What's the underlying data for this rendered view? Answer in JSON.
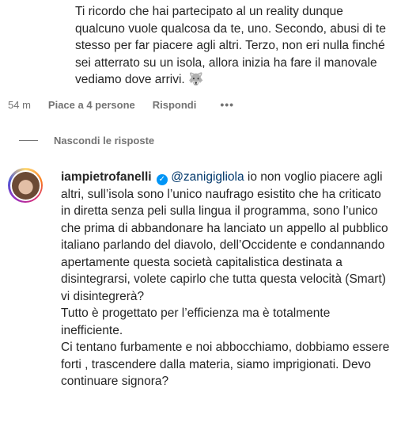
{
  "comment1": {
    "text": "Ti ricordo che hai partecipato al un reality dunque qualcuno vuole qualcosa da te, uno. Secondo, abusi di te stesso per far piacere agli altri. Terzo, non eri nulla finché sei atterrato su un isola, allora inizia ha fare il manovale vediamo dove arrivi. 🐺",
    "time": "54 m",
    "likes": "Piace a 4 persone",
    "reply": "Rispondi",
    "more": "•••"
  },
  "hide_replies": "Nascondi le risposte",
  "reply_comment": {
    "username": "iampietrofanelli",
    "verified_icon": "✓",
    "mention": "@zanigigliola",
    "text": " io non voglio piacere agli altri, sull’isola sono l’unico naufrago esistito che ha criticato in diretta senza peli sulla lingua il programma, sono l’unico che prima di abbandonare ha lanciato un appello al pubblico italiano parlando del diavolo, dell’Occidente e condannando apertamente questa società capitalistica destinata a disintegrarsi, volete capirlo che tutta questa velocità (Smart) vi disintegrerà?",
    "text2": "Tutto è progettato per l’efficienza ma è totalmente inefficiente.",
    "text3": "Ci tentano furbamente e noi abbocchiamo, dobbiamo essere forti , trascendere dalla materia, siamo imprigionati. Devo continuare signora?"
  },
  "colors": {
    "mention": "#00376b",
    "verified": "#0095f6",
    "meta": "#737373"
  }
}
